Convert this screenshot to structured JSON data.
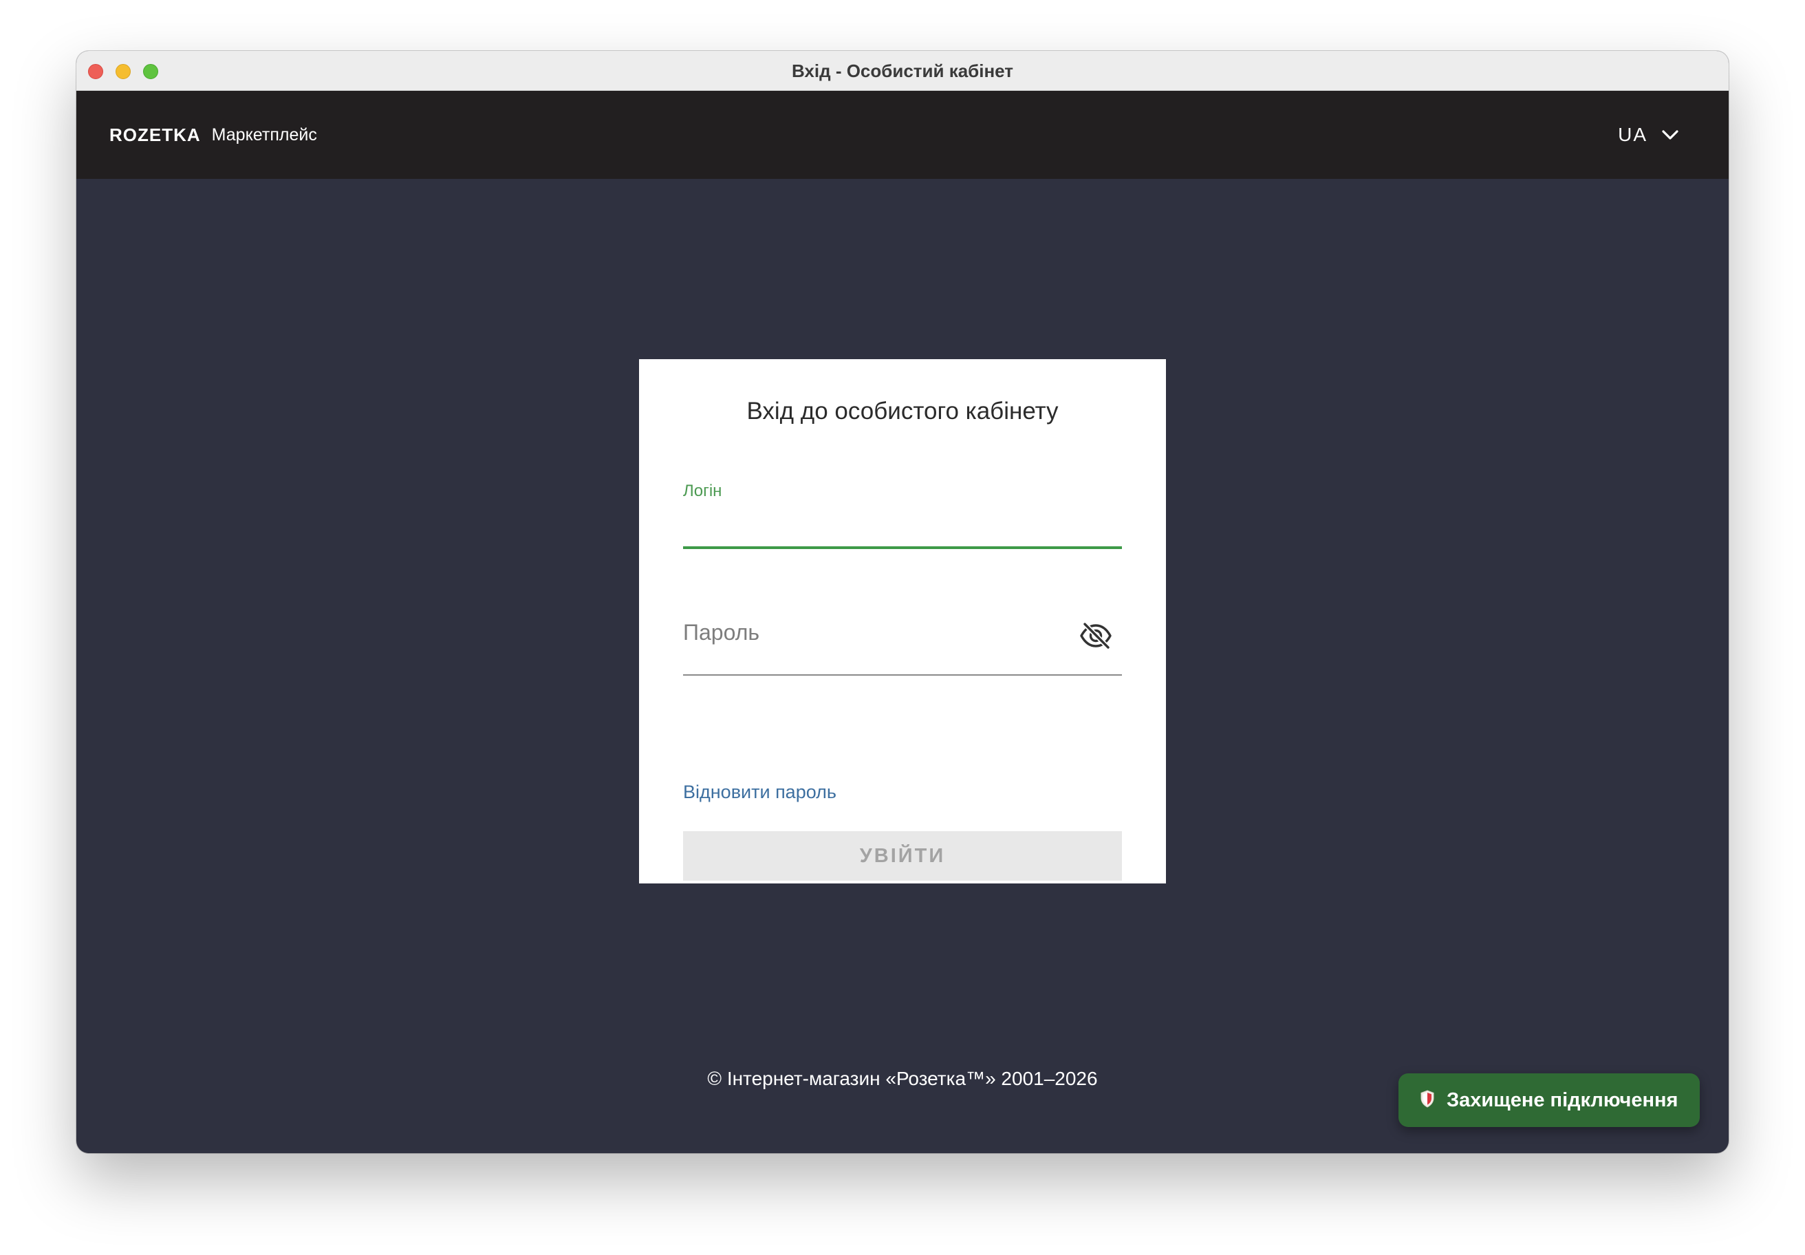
{
  "window": {
    "title": "Вхід - Особистий кабінет"
  },
  "navbar": {
    "logo": "ROZETKA",
    "subtitle": "Маркетплейс",
    "language": "UA"
  },
  "login_card": {
    "title": "Вхід до особистого кабінету",
    "login_label": "Логін",
    "login_value": "",
    "password_placeholder": "Пароль",
    "password_value": "",
    "restore_link": "Відновити пароль",
    "submit_label": "УВІЙТИ"
  },
  "footer": {
    "copyright": "© Інтернет-магазин «Розетка™» 2001–2026"
  },
  "secure_badge": {
    "label": "Захищене підключення",
    "icon": "shield-icon"
  },
  "colors": {
    "page_background": "#2f3140",
    "navbar_background": "#221f20",
    "accent_green": "#3e9a48",
    "link_blue": "#3d6fa0",
    "badge_green": "#2f6a34"
  }
}
